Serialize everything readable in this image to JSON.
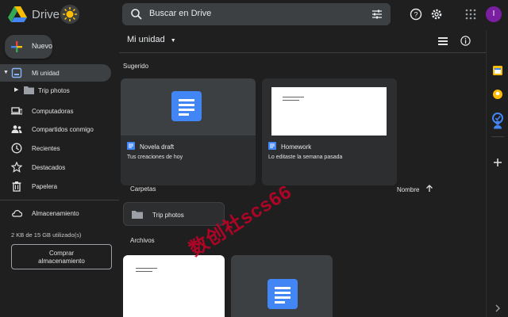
{
  "app": {
    "brand": "Drive",
    "avatar_initial": "I"
  },
  "search": {
    "placeholder": "Buscar en Drive"
  },
  "sidebar": {
    "new_label": "Nuevo",
    "items": [
      {
        "label": "Mi unidad",
        "icon": "my-drive-icon"
      },
      {
        "label": "Trip photos",
        "icon": "folder-icon"
      },
      {
        "label": "Computadoras",
        "icon": "computers-icon"
      },
      {
        "label": "Compartidos conmigo",
        "icon": "shared-icon"
      },
      {
        "label": "Recientes",
        "icon": "clock-icon"
      },
      {
        "label": "Destacados",
        "icon": "star-icon"
      },
      {
        "label": "Papelera",
        "icon": "trash-icon"
      },
      {
        "label": "Almacenamiento",
        "icon": "cloud-icon"
      }
    ],
    "storage_used": "2 KB de 15 GB utilizado(s)",
    "buy_storage_line1": "Comprar",
    "buy_storage_line2": "almacenamiento"
  },
  "main": {
    "title": "Mi unidad",
    "suggested_label": "Sugerido",
    "suggested": [
      {
        "name": "Novela draft",
        "subtitle": "Tus creaciones de hoy"
      },
      {
        "name": "Homework",
        "subtitle": "Lo editaste la semana pasada"
      }
    ],
    "folders_label": "Carpetas",
    "sort_label": "Nombre",
    "folders": [
      {
        "name": "Trip photos"
      }
    ],
    "files_label": "Archivos"
  },
  "watermark": "数创社scs66",
  "colors": {
    "background": "#1f1f1f",
    "surface": "#2d2e30",
    "docs_blue": "#4285f4"
  }
}
